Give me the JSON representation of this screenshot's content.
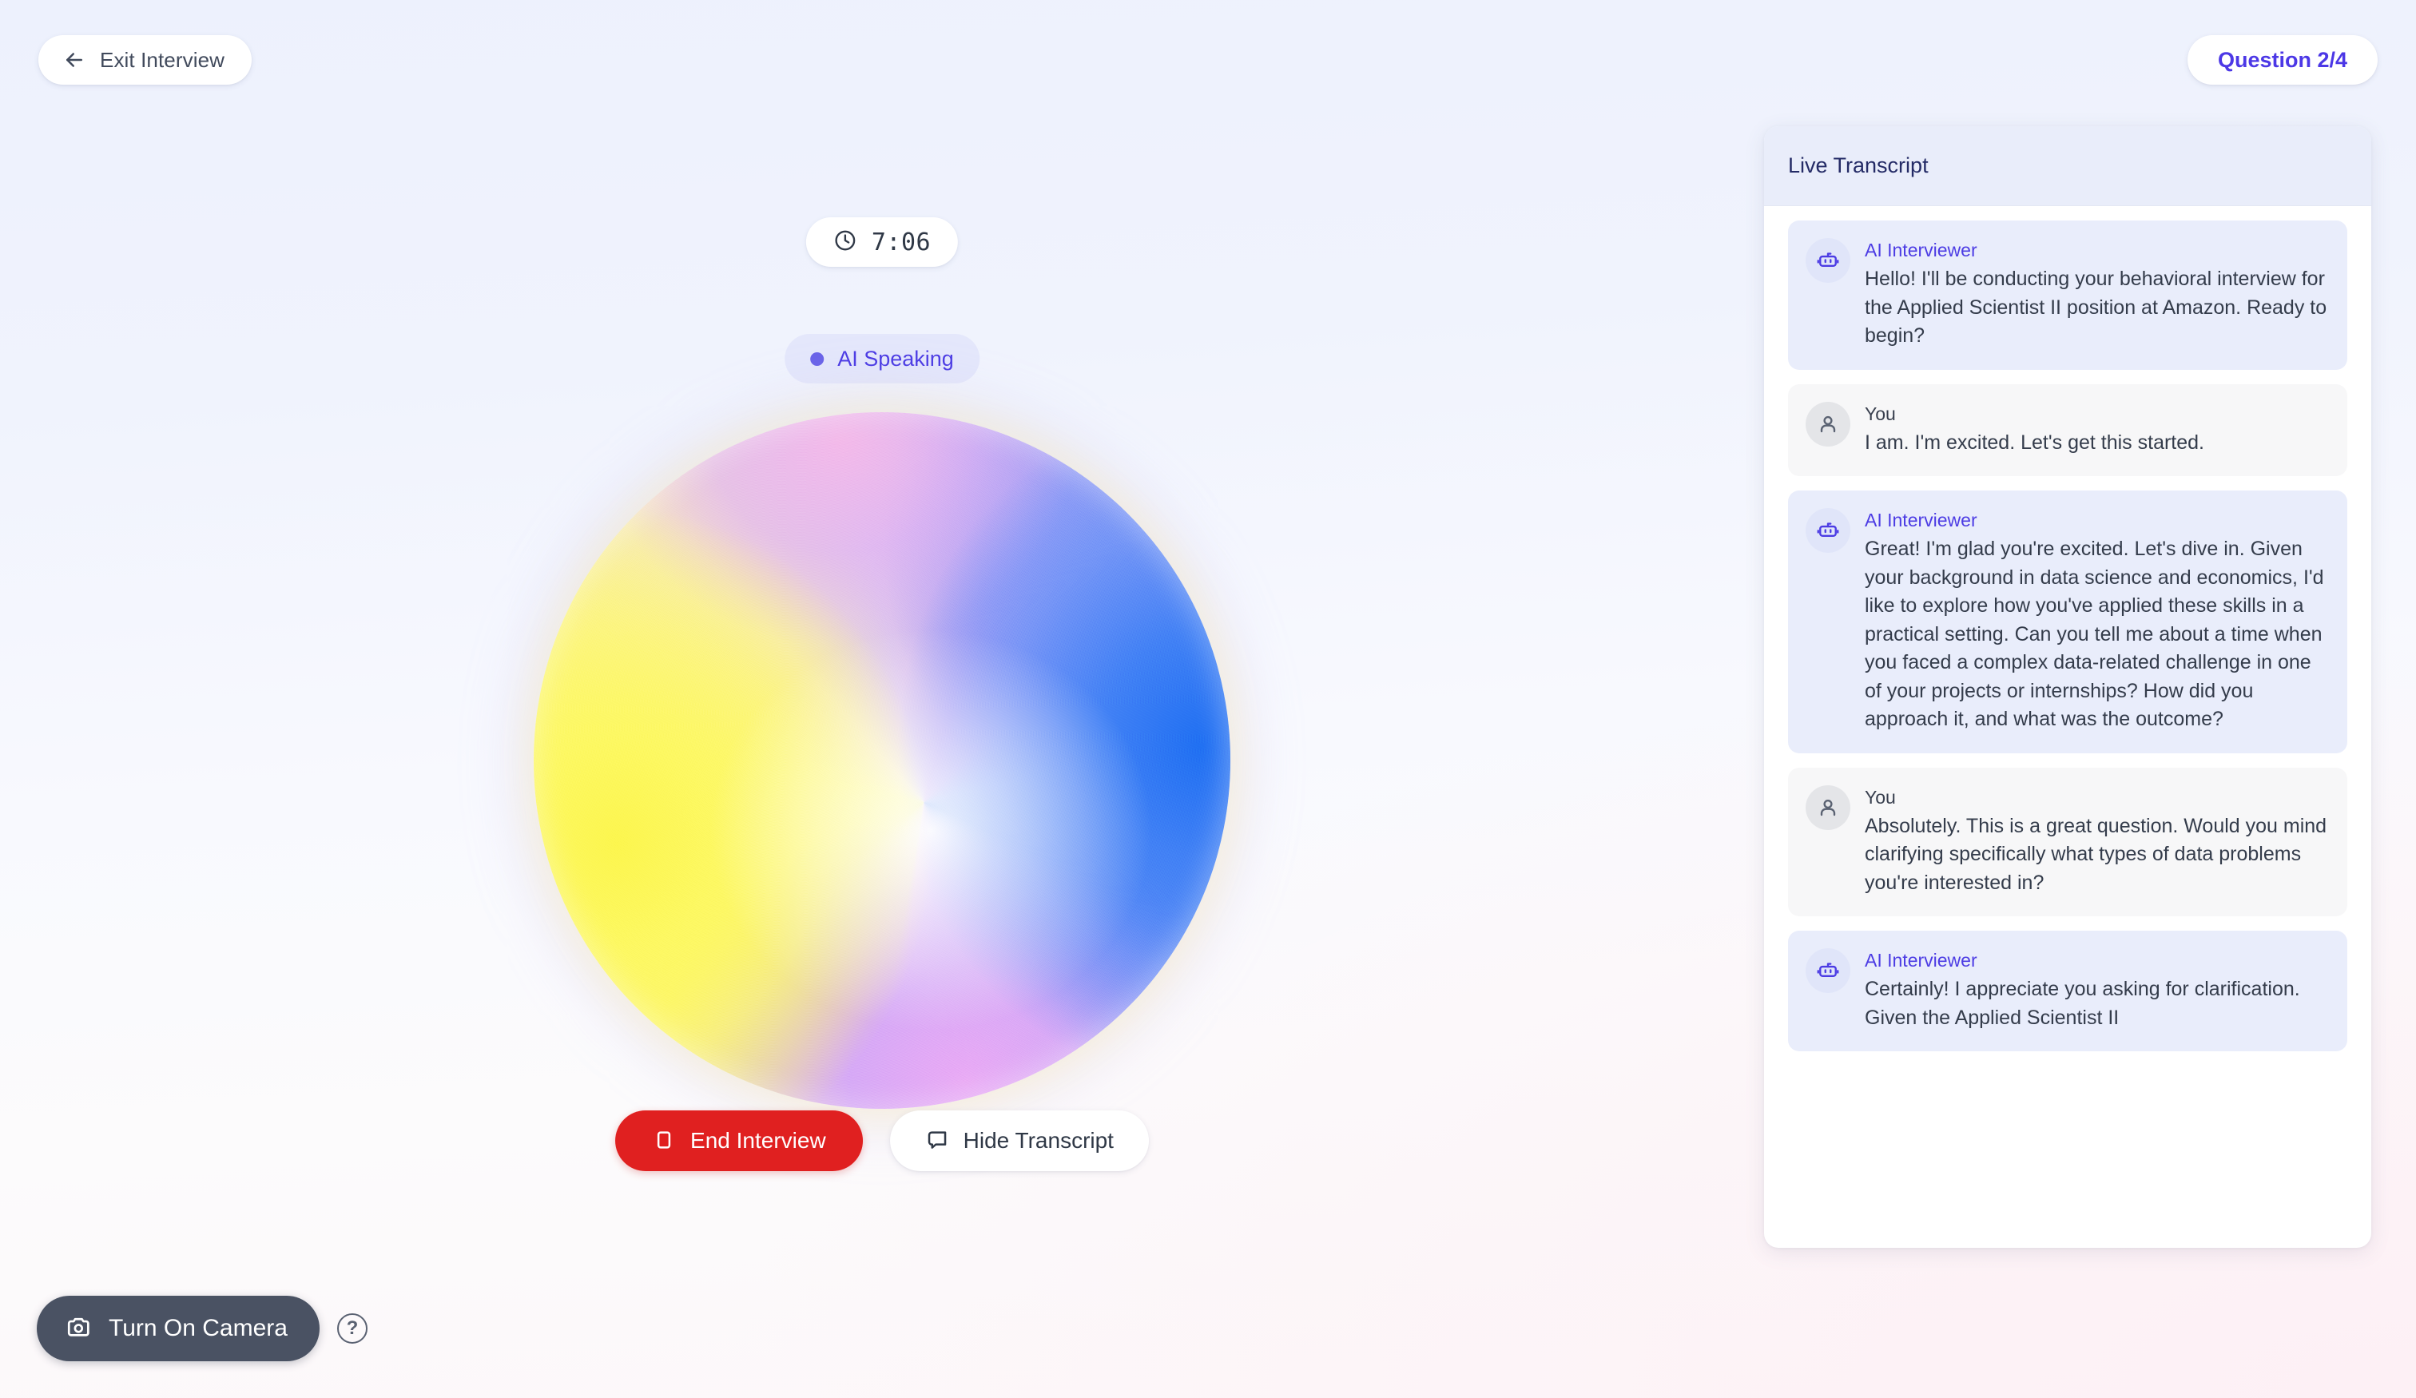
{
  "header": {
    "exit_label": "Exit Interview",
    "exit_icon": "arrow-left-icon",
    "question_label": "Question 2/4"
  },
  "stage": {
    "timer": {
      "icon": "clock-icon",
      "value": "7:06"
    },
    "status": {
      "icon": "status-dot-icon",
      "label": "AI Speaking"
    },
    "orb": {
      "name": "ai-voice-orb",
      "colors": {
        "yellow": "#FBF55C",
        "blue": "#2F74F3",
        "magenta": "#D5A6F6",
        "pink": "#F3B7E9",
        "highlight": "#FFFFFF"
      }
    },
    "actions": {
      "end_label": "End Interview",
      "end_icon": "stop-square-icon",
      "end_color": "#E02020",
      "hide_label": "Hide Transcript",
      "hide_icon": "speech-bubble-icon"
    }
  },
  "camera_bar": {
    "camera_label": "Turn On Camera",
    "camera_icon": "camera-icon",
    "help_icon": "question-mark-circle-icon",
    "help_label": "?"
  },
  "transcript": {
    "title": "Live Transcript",
    "messages": [
      {
        "role": "ai",
        "author": "AI Interviewer",
        "icon": "robot-icon",
        "text": "Hello! I'll be conducting your behavioral interview for the Applied Scientist II position at Amazon. Ready to begin?"
      },
      {
        "role": "user",
        "author": "You",
        "icon": "person-icon",
        "text": "I am. I'm excited. Let's get this started."
      },
      {
        "role": "ai",
        "author": "AI Interviewer",
        "icon": "robot-icon",
        "text": "Great! I'm glad you're excited. Let's dive in. Given your background in data science and economics, I'd like to explore how you've applied these skills in a practical setting. Can you tell me about a time when you faced a complex data-related challenge in one of your projects or internships? How did you approach it, and what was the outcome?"
      },
      {
        "role": "user",
        "author": "You",
        "icon": "person-icon",
        "text": "Absolutely. This is a great question. Would you mind clarifying specifically what types of data problems you're interested in?"
      },
      {
        "role": "ai",
        "author": "AI Interviewer",
        "icon": "robot-icon",
        "text": "Certainly! I appreciate you asking for clarification. Given the Applied Scientist II"
      }
    ]
  },
  "theme": {
    "accent": "#4C38E6",
    "danger": "#E02020",
    "panel_header_bg": "#E9EDFA",
    "ai_bubble_bg": "#E9EDFB",
    "user_bubble_bg": "#F7F7F8"
  }
}
